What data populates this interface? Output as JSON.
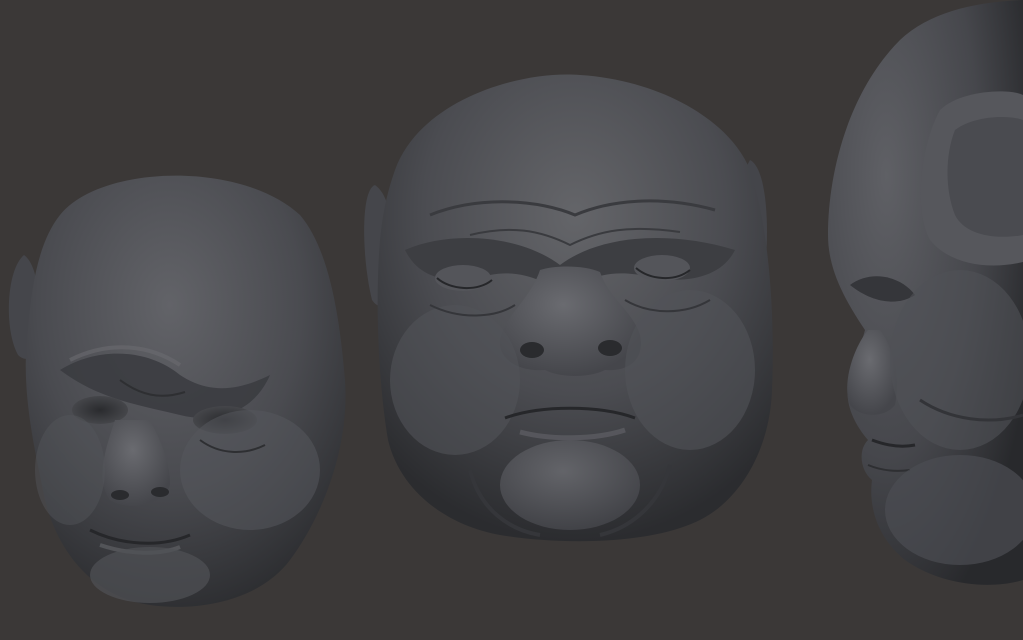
{
  "scene": {
    "background_color": "#3b3837",
    "material_color": "#4a4b4f",
    "highlight_color": "#6a6b70",
    "shadow_color": "#202124",
    "views": [
      {
        "view": "three-quarter"
      },
      {
        "view": "front"
      },
      {
        "view": "side-profile"
      }
    ]
  }
}
